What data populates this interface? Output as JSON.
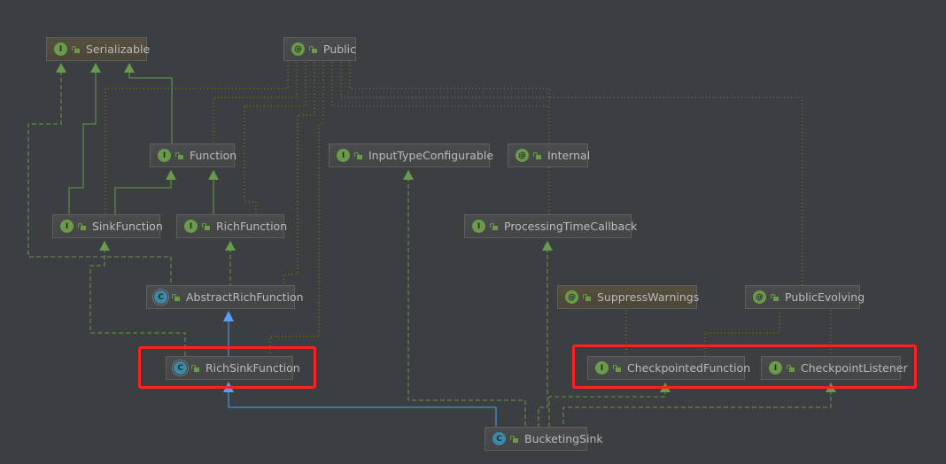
{
  "nodes": [
    {
      "id": "serializable",
      "label": "Serializable",
      "kind": "interface",
      "kind_glyph": "I"
    },
    {
      "id": "public",
      "label": "Public",
      "kind": "annotation",
      "kind_glyph": "@"
    },
    {
      "id": "function",
      "label": "Function",
      "kind": "interface",
      "kind_glyph": "I"
    },
    {
      "id": "input-type-configurable",
      "label": "InputTypeConfigurable",
      "kind": "interface",
      "kind_glyph": "I"
    },
    {
      "id": "internal",
      "label": "Internal",
      "kind": "annotation",
      "kind_glyph": "@"
    },
    {
      "id": "sink-function",
      "label": "SinkFunction",
      "kind": "interface",
      "kind_glyph": "I"
    },
    {
      "id": "rich-function",
      "label": "RichFunction",
      "kind": "interface",
      "kind_glyph": "I"
    },
    {
      "id": "processing-time-callback",
      "label": "ProcessingTimeCallback",
      "kind": "interface",
      "kind_glyph": "I"
    },
    {
      "id": "abstract-rich-function",
      "label": "AbstractRichFunction",
      "kind": "abstract-class",
      "kind_glyph": "C"
    },
    {
      "id": "suppress-warnings",
      "label": "SuppressWarnings",
      "kind": "annotation",
      "kind_glyph": "@"
    },
    {
      "id": "public-evolving",
      "label": "PublicEvolving",
      "kind": "annotation",
      "kind_glyph": "@"
    },
    {
      "id": "rich-sink-function",
      "label": "RichSinkFunction",
      "kind": "abstract-class",
      "kind_glyph": "C"
    },
    {
      "id": "checkpointed-function",
      "label": "CheckpointedFunction",
      "kind": "interface",
      "kind_glyph": "I"
    },
    {
      "id": "checkpoint-listener",
      "label": "CheckpointListener",
      "kind": "interface",
      "kind_glyph": "I"
    },
    {
      "id": "bucketing-sink",
      "label": "BucketingSink",
      "kind": "class",
      "kind_glyph": "C"
    }
  ],
  "colors": {
    "background": "#3c3f41",
    "extends_edge": "#589df6",
    "implements_edge": "#6a9a4a",
    "annotation_edge": "#8a8a00",
    "highlight": "#ff2020"
  }
}
